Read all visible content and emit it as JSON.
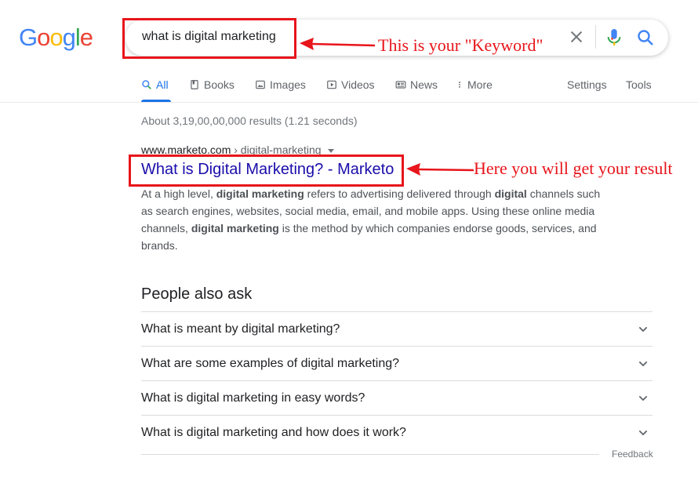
{
  "logo": {
    "text": "Google"
  },
  "search": {
    "query": "what is digital marketing"
  },
  "annotations": {
    "keyword": "This is your \"Keyword\"",
    "result": "Here you will get your result"
  },
  "tabs": [
    {
      "label": "All",
      "icon": "search-icon",
      "active": true
    },
    {
      "label": "Books",
      "icon": "book-icon"
    },
    {
      "label": "Images",
      "icon": "image-icon"
    },
    {
      "label": "Videos",
      "icon": "video-icon"
    },
    {
      "label": "News",
      "icon": "news-icon"
    },
    {
      "label": "More",
      "icon": "more-vert-icon"
    }
  ],
  "tools": {
    "settings": "Settings",
    "tools": "Tools"
  },
  "stats": "About 3,19,00,00,000 results (1.21 seconds)",
  "result": {
    "site": "www.marketo.com",
    "crumb": " › digital-marketing",
    "title": "What is Digital Marketing? - Marketo",
    "snippet": [
      {
        "t": "At a high level, ",
        "b": false
      },
      {
        "t": "digital marketing",
        "b": true
      },
      {
        "t": " refers to advertising delivered through ",
        "b": false
      },
      {
        "t": "digital",
        "b": true
      },
      {
        "t": " channels such as search engines, websites, social media, email, and mobile apps. Using these online media channels, ",
        "b": false
      },
      {
        "t": "digital marketing",
        "b": true
      },
      {
        "t": " is the method by which companies endorse goods, services, and brands.",
        "b": false
      }
    ]
  },
  "people_also_ask": {
    "title": "People also ask",
    "questions": [
      "What is meant by digital marketing?",
      "What are some examples of digital marketing?",
      "What is digital marketing in easy words?",
      "What is digital marketing and how does it work?"
    ]
  },
  "feedback": "Feedback",
  "colors": {
    "link": "#1a0dab",
    "accent": "#1a73e8",
    "annotation": "#e8151b"
  }
}
